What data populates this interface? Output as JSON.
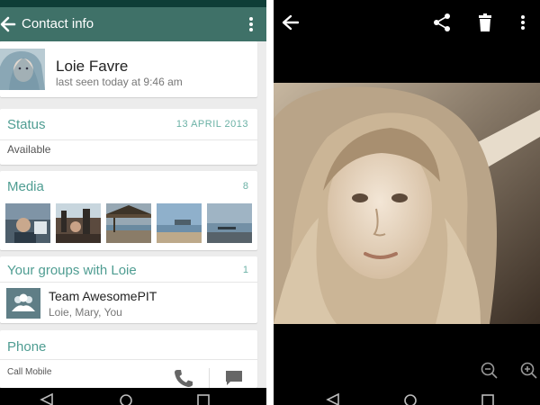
{
  "contact_screen": {
    "appbar": {
      "title": "Contact info",
      "back_icon": "arrow-back-icon",
      "menu_icon": "more-vertical-icon",
      "color": "#3f7168"
    },
    "contact": {
      "name": "Loie Favre",
      "last_seen": "last seen today at 9:46 am"
    },
    "status": {
      "title": "Status",
      "date": "13 APRIL 2013",
      "value": "Available"
    },
    "media": {
      "title": "Media",
      "count": "8"
    },
    "groups": {
      "title": "Your groups with Loie",
      "count": "1",
      "items": [
        {
          "name": "Team AwesomePIT",
          "members": "Loie, Mary, You"
        }
      ]
    },
    "phone": {
      "title": "Phone",
      "type": "Call Mobile",
      "call_icon": "phone-icon",
      "message_icon": "message-icon"
    },
    "accent_color": "#4f9d92"
  },
  "photo_screen": {
    "toolbar_icons": [
      "arrow-back-icon",
      "share-icon",
      "delete-icon",
      "more-vertical-icon"
    ],
    "zoom_icons": [
      "zoom-out-icon",
      "zoom-in-icon"
    ]
  },
  "navigation_icons": [
    "back-nav-icon",
    "home-nav-icon",
    "recents-nav-icon"
  ]
}
